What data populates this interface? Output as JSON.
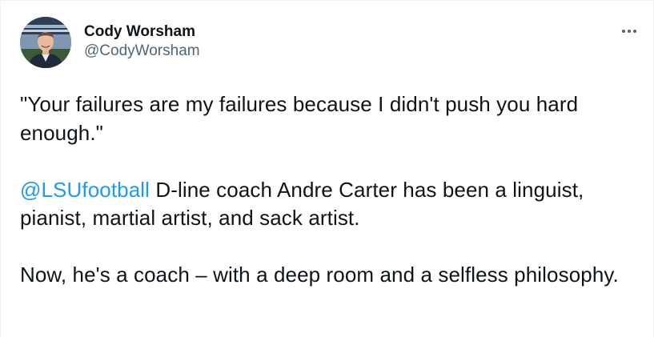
{
  "tweet": {
    "author": {
      "display_name": "Cody Worsham",
      "handle": "@CodyWorsham"
    },
    "more_label": "More",
    "paragraphs": [
      {
        "text": "\"Your failures are my failures because I didn't push you hard enough.\""
      },
      {
        "mention": "@LSUfootball",
        "text": " D-line coach Andre Carter has been a linguist, pianist, martial artist, and sack artist."
      },
      {
        "text": "Now, he's a coach – with a deep room and a selfless philosophy."
      }
    ]
  },
  "colors": {
    "text": "#0f1419",
    "secondary": "#536471",
    "link": "#1d9bf0",
    "border": "#eff3f4"
  },
  "icons": {
    "more": "more-horizontal-icon",
    "avatar": "profile-photo"
  }
}
